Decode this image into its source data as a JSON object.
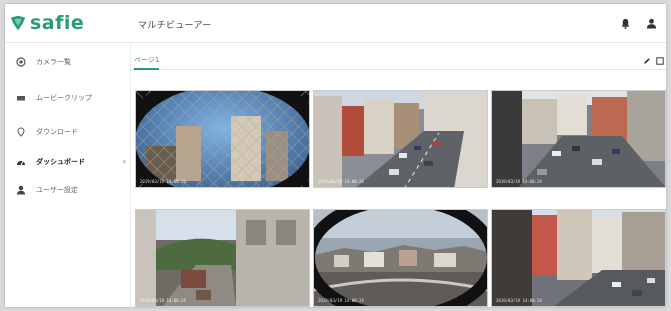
{
  "app": {
    "logo_text": "safie",
    "page_heading": "マルチビューアー",
    "accent": "#2b9a78"
  },
  "header_icons": [
    {
      "name": "bell-icon"
    },
    {
      "name": "user-icon"
    }
  ],
  "sidebar": {
    "items": [
      {
        "label": "カメラ一覧",
        "icon": "camera-icon"
      },
      {
        "label": "ムービークリップ",
        "icon": "movie-icon"
      },
      {
        "label": "ダウンロード",
        "icon": "location-icon"
      },
      {
        "label": "ダッシュボード",
        "icon": "dashboard-icon",
        "active": true,
        "has_submenu": true
      },
      {
        "label": "ユーザー設定",
        "icon": "user-settings-icon"
      }
    ]
  },
  "main": {
    "tabs": [
      {
        "label": "ページ1",
        "active": true
      }
    ],
    "tools": [
      "edit-icon",
      "fullscreen-icon"
    ]
  },
  "cameras": [
    {
      "name": "camera-tile-1",
      "scene": "fence",
      "timestamp": "2019/03/19 14:00:24"
    },
    {
      "name": "camera-tile-2",
      "scene": "street",
      "timestamp": "2019/03/19 14:00:24"
    },
    {
      "name": "camera-tile-3",
      "scene": "street",
      "timestamp": "2019/03/19 14:00:24"
    },
    {
      "name": "camera-tile-4",
      "scene": "alley",
      "timestamp": "2019/03/19 14:00:24"
    },
    {
      "name": "camera-tile-5",
      "scene": "rooftop",
      "timestamp": "2019/03/19 14:00:24"
    },
    {
      "name": "camera-tile-6",
      "scene": "street",
      "timestamp": "2019/03/19 14:00:24"
    }
  ]
}
